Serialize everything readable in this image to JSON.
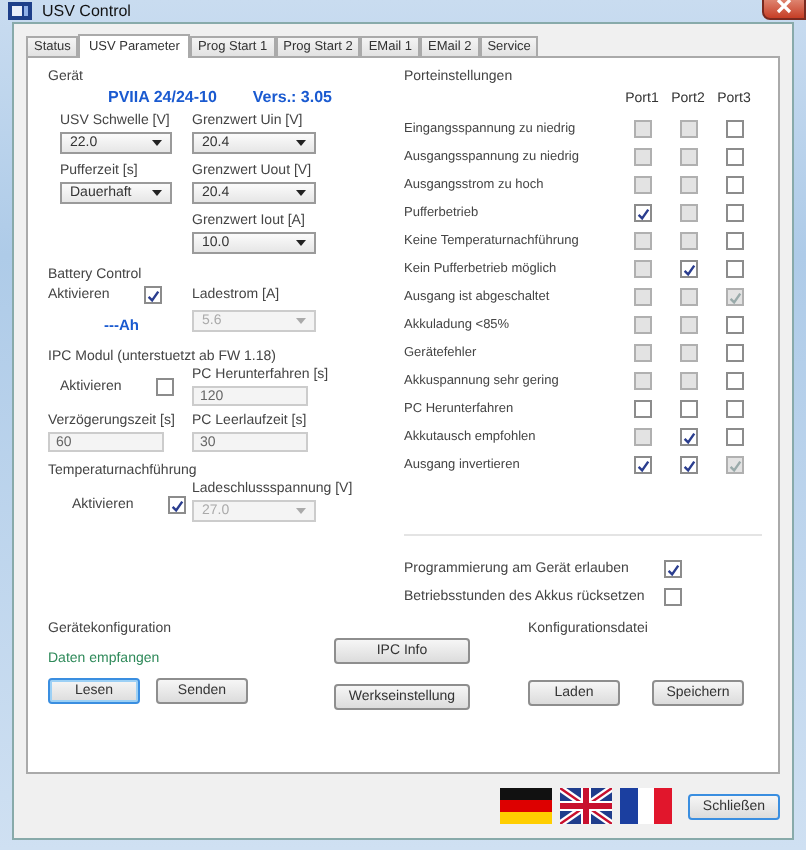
{
  "window": {
    "title": "USV Control"
  },
  "tabs": [
    {
      "label": "Status",
      "selected": false
    },
    {
      "label": "USV Parameter",
      "selected": true
    },
    {
      "label": "Prog Start 1",
      "selected": false
    },
    {
      "label": "Prog Start 2",
      "selected": false
    },
    {
      "label": "EMail 1",
      "selected": false
    },
    {
      "label": "EMail 2",
      "selected": false
    },
    {
      "label": "Service",
      "selected": false
    }
  ],
  "device": {
    "label": "Gerät",
    "model": "PVIIA 24/24-10",
    "version": "Vers.: 3.05"
  },
  "settings_columns": [
    [
      {
        "label": "USV Schwelle [V]",
        "value": "22.0"
      },
      {
        "label": "Pufferzeit [s]",
        "value": "Dauerhaft"
      }
    ],
    [
      {
        "label": "Grenzwert Uin [V]",
        "value": "20.4"
      },
      {
        "label": "Grenzwert Uout [V]",
        "value": "20.4"
      },
      {
        "label": "Grenzwert Iout [A]",
        "value": "10.0"
      }
    ]
  ],
  "battery": {
    "title": "Battery Control",
    "activate": {
      "label": "Aktivieren",
      "checked": true
    },
    "capacity": "---Ah",
    "charge_current": {
      "label": "Ladestrom [A]",
      "value": "5.6",
      "disabled": true
    }
  },
  "ipc": {
    "title": "IPC Modul (unterstuetzt ab FW 1.18)",
    "activate": {
      "label": "Aktivieren",
      "checked": false
    },
    "fields": [
      {
        "label": "PC Herunterfahren [s]",
        "value": "120",
        "disabled": true
      },
      {
        "label": "Verzögerungszeit [s]",
        "value": "60",
        "disabled": true
      },
      {
        "label": "PC Leerlaufzeit [s]",
        "value": "30",
        "disabled": true
      }
    ]
  },
  "temperature": {
    "title": "Temperaturnachführung",
    "activate": {
      "label": "Aktivieren",
      "checked": true
    },
    "end_voltage": {
      "label": "Ladeschlussspannung [V]",
      "value": "27.0",
      "disabled": true
    }
  },
  "ports": {
    "title": "Porteinstellungen",
    "columns": [
      "Port1",
      "Port2",
      "Port3"
    ],
    "rows": [
      {
        "label": "Eingangsspannung zu niedrig",
        "ports": [
          {
            "checked": false,
            "disabled": true
          },
          {
            "checked": false,
            "disabled": true
          },
          {
            "checked": false,
            "disabled": false
          }
        ]
      },
      {
        "label": "Ausgangsspannung zu niedrig",
        "ports": [
          {
            "checked": false,
            "disabled": true
          },
          {
            "checked": false,
            "disabled": true
          },
          {
            "checked": false,
            "disabled": false
          }
        ]
      },
      {
        "label": "Ausgangsstrom zu hoch",
        "ports": [
          {
            "checked": false,
            "disabled": true
          },
          {
            "checked": false,
            "disabled": true
          },
          {
            "checked": false,
            "disabled": false
          }
        ]
      },
      {
        "label": "Pufferbetrieb",
        "ports": [
          {
            "checked": true,
            "disabled": false
          },
          {
            "checked": false,
            "disabled": true
          },
          {
            "checked": false,
            "disabled": false
          }
        ]
      },
      {
        "label": "Keine Temperaturnachführung",
        "ports": [
          {
            "checked": false,
            "disabled": true
          },
          {
            "checked": false,
            "disabled": true
          },
          {
            "checked": false,
            "disabled": false
          }
        ]
      },
      {
        "label": "Kein Pufferbetrieb möglich",
        "ports": [
          {
            "checked": false,
            "disabled": true
          },
          {
            "checked": true,
            "disabled": false
          },
          {
            "checked": false,
            "disabled": false
          }
        ]
      },
      {
        "label": "Ausgang ist abgeschaltet",
        "ports": [
          {
            "checked": false,
            "disabled": true
          },
          {
            "checked": false,
            "disabled": true
          },
          {
            "checked": true,
            "disabled": true
          }
        ]
      },
      {
        "label": "Akkuladung <85%",
        "ports": [
          {
            "checked": false,
            "disabled": true
          },
          {
            "checked": false,
            "disabled": true
          },
          {
            "checked": false,
            "disabled": false
          }
        ]
      },
      {
        "label": "Gerätefehler",
        "ports": [
          {
            "checked": false,
            "disabled": true
          },
          {
            "checked": false,
            "disabled": true
          },
          {
            "checked": false,
            "disabled": false
          }
        ]
      },
      {
        "label": "Akkuspannung sehr gering",
        "ports": [
          {
            "checked": false,
            "disabled": true
          },
          {
            "checked": false,
            "disabled": true
          },
          {
            "checked": false,
            "disabled": false
          }
        ]
      },
      {
        "label": "PC Herunterfahren",
        "ports": [
          {
            "checked": false,
            "disabled": false
          },
          {
            "checked": false,
            "disabled": false
          },
          {
            "checked": false,
            "disabled": false
          }
        ]
      },
      {
        "label": "Akkutausch empfohlen",
        "ports": [
          {
            "checked": false,
            "disabled": true
          },
          {
            "checked": true,
            "disabled": false
          },
          {
            "checked": false,
            "disabled": false
          }
        ]
      },
      {
        "label": "Ausgang invertieren",
        "ports": [
          {
            "checked": true,
            "disabled": false
          },
          {
            "checked": true,
            "disabled": false
          },
          {
            "checked": true,
            "disabled": true
          }
        ]
      }
    ]
  },
  "options": [
    {
      "label": "Programmierung am Gerät erlauben",
      "checked": true
    },
    {
      "label": "Betriebsstunden des Akkus rücksetzen",
      "checked": false
    }
  ],
  "config": {
    "title": "Gerätekonfiguration",
    "status": "Daten empfangen",
    "buttons": [
      {
        "label": "Lesen",
        "focused": true
      },
      {
        "label": "Senden",
        "focused": false
      }
    ]
  },
  "tools": {
    "buttons": [
      "IPC Info",
      "Werkseinstellung"
    ]
  },
  "file": {
    "title": "Konfigurationsdatei",
    "buttons": [
      "Laden",
      "Speichern"
    ]
  },
  "footer": {
    "flags": [
      {
        "kind": "de"
      },
      {
        "kind": "uk"
      },
      {
        "kind": "fr"
      }
    ],
    "button": "Schließen"
  }
}
